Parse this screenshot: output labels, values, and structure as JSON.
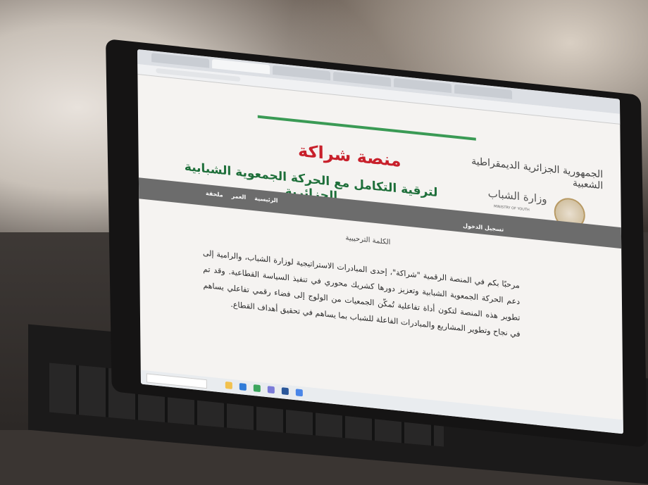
{
  "browser": {
    "tabs": [
      "",
      "",
      "",
      "",
      "",
      ""
    ]
  },
  "site": {
    "title": "منصة شراكة",
    "subtitle": "لترقية التكامل مع الحركة الجمعوية الشبابية الجزائرية",
    "gov_name": "الجمهورية الجزائرية الديمقراطية الشعبية",
    "ministry": "وزارة الشباب",
    "ministry_en": "MINISTRY OF YOUTH"
  },
  "nav": {
    "items": [
      "الرئيسية",
      "العمر",
      "ملحقة"
    ],
    "login": "تسجيل الدخول"
  },
  "content": {
    "section_title": "الكلمة الترحيبية",
    "body": "مرحبًا بكم في المنصة الرقمية \"شراكة\"، إحدى المبادرات الاستراتيجية لوزارة الشباب، والرامية إلى دعم الحركة الجمعوية الشبابية وتعزيز دورها كشريك محوري في تنفيذ السياسة القطاعية. وقد تم تطوير هذه المنصة لتكون أداة تفاعلية تُمكّن الجمعيات من الولوج إلى فضاء رقمي تفاعلي يساهم في نجاح وتطوير المشاريع والمبادرات الفاعلة للشباب بما يساهم في تحقيق أهداف القطاع."
  },
  "taskbar": {
    "search_placeholder": "",
    "clock": ""
  },
  "colors": {
    "title_red": "#c8202b",
    "subtitle_green": "#1e6f3a",
    "nav_gray": "#6c6c6c",
    "progress_green": "#3a9a55"
  }
}
